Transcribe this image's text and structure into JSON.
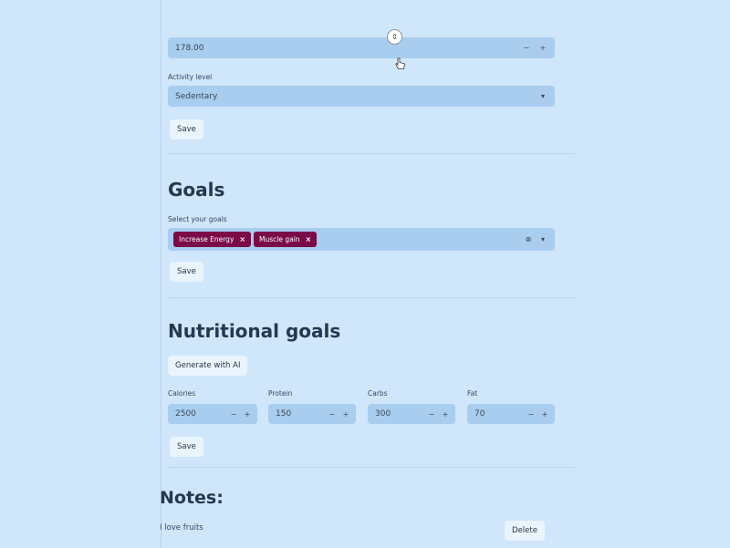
{
  "profile": {
    "height_value": "178.00",
    "activity_label": "Activity level",
    "activity_value": "Sedentary",
    "save_label": "Save"
  },
  "goals": {
    "title": "Goals",
    "select_label": "Select your goals",
    "chips": [
      "Increase Energy",
      "Muscle gain"
    ],
    "save_label": "Save"
  },
  "nutrition": {
    "title": "Nutritional goals",
    "generate_label": "Generate with AI",
    "fields": [
      {
        "label": "Calories",
        "value": "2500"
      },
      {
        "label": "Protein",
        "value": "150"
      },
      {
        "label": "Carbs",
        "value": "300"
      },
      {
        "label": "Fat",
        "value": "70"
      }
    ],
    "save_label": "Save"
  },
  "notes": {
    "title": "Notes:",
    "items": [
      {
        "text": "I love fruits",
        "delete_label": "Delete"
      }
    ]
  },
  "icons": {
    "chip_remove": "×",
    "clear": "×",
    "minus": "−",
    "caret": "▾"
  }
}
